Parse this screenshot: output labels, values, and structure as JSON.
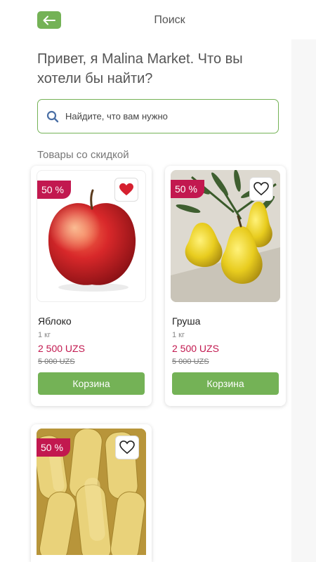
{
  "header": {
    "title": "Поиск",
    "back_icon": "arrow-left-icon"
  },
  "greeting": "Привет, я Malina Market. Что вы хотели бы найти?",
  "search": {
    "placeholder": "Найдите, что вам нужно",
    "value": "",
    "icon": "search-icon"
  },
  "section_title": "Товары со скидкой",
  "colors": {
    "accent": "#74b256",
    "discount": "#c2184f",
    "price": "#c2184f"
  },
  "products": [
    {
      "name": "Яблоко",
      "unit": "1 кг",
      "price": "2 500 UZS",
      "old_price": "5 000 UZS",
      "discount": "50 %",
      "favorite": true,
      "cart_label": "Корзина"
    },
    {
      "name": "Груша",
      "unit": "1 кг",
      "price": "2 500 UZS",
      "old_price": "5 000 UZS",
      "discount": "50 %",
      "favorite": false,
      "cart_label": "Корзина"
    },
    {
      "discount": "50 %",
      "favorite": false
    }
  ]
}
